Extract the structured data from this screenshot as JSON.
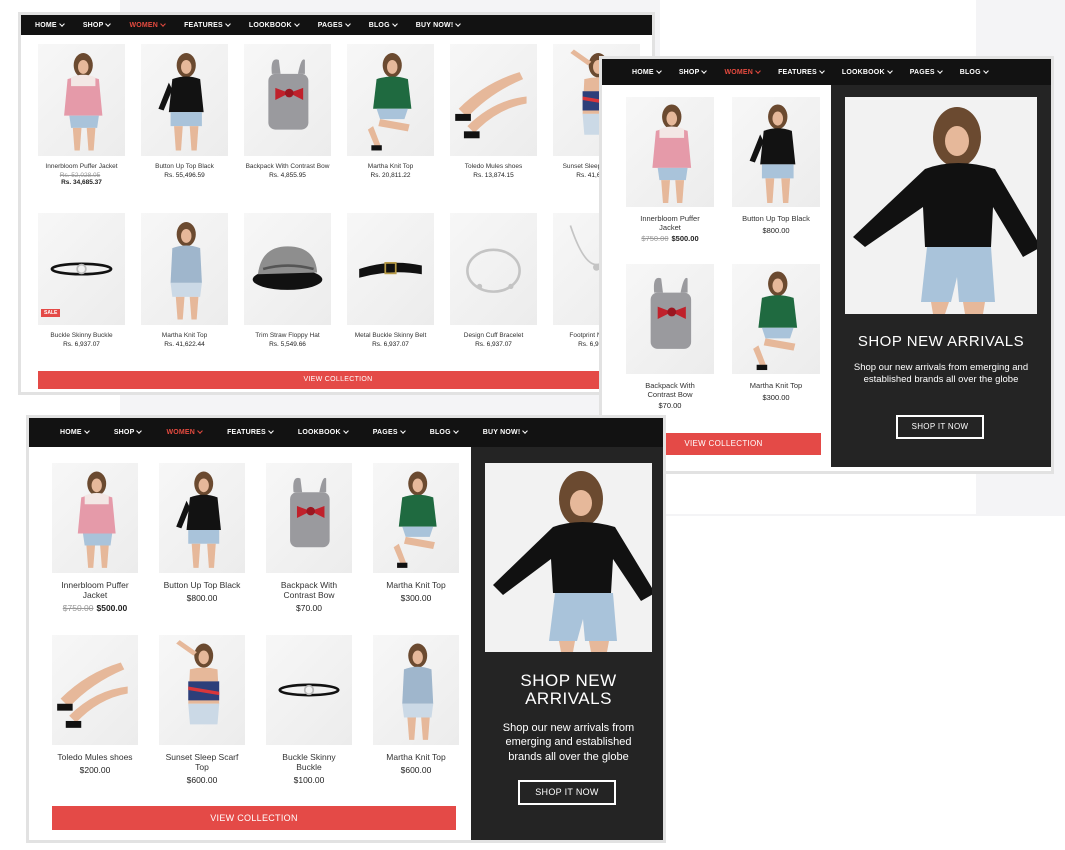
{
  "colors": {
    "nav_bg": "#121212",
    "accent": "#e44a3f",
    "button": "#e44a47",
    "promo_bg": "#242424"
  },
  "screen1": {
    "nav": [
      "HOME",
      "SHOP",
      "WOMEN",
      "FEATURES",
      "LOOKBOOK",
      "PAGES",
      "BLOG",
      "BUY NOW!"
    ],
    "products": [
      {
        "name": "Innerbloom Puffer Jacket",
        "old": "Rs. 52,028.05",
        "price": "Rs. 34,685.37",
        "kind": "woman-pink"
      },
      {
        "name": "Button Up Top Black",
        "old": "",
        "price": "Rs. 55,496.59",
        "kind": "woman-black"
      },
      {
        "name": "Backpack With Contrast Bow",
        "old": "",
        "price": "Rs. 4,855.95",
        "kind": "backpack"
      },
      {
        "name": "Martha Knit Top",
        "old": "",
        "price": "Rs. 20,811.22",
        "kind": "woman-green"
      },
      {
        "name": "Toledo Mules shoes",
        "old": "",
        "price": "Rs. 13,874.15",
        "kind": "legs"
      },
      {
        "name": "Sunset Sleep Scarf Top",
        "old": "",
        "price": "Rs. 41,622.44",
        "kind": "woman-scarf"
      },
      {
        "name": "Buckle Skinny Buckle",
        "old": "",
        "price": "Rs. 6,937.07",
        "kind": "belt-thin",
        "badge": "SALE"
      },
      {
        "name": "Martha Knit Top",
        "old": "",
        "price": "Rs. 41,622.44",
        "kind": "woman-denim"
      },
      {
        "name": "Trim Straw Floppy Hat",
        "old": "",
        "price": "Rs. 5,549.66",
        "kind": "hat"
      },
      {
        "name": "Metal Buckle Skinny Belt",
        "old": "",
        "price": "Rs. 6,937.07",
        "kind": "belt"
      },
      {
        "name": "Design Cuff Bracelet",
        "old": "",
        "price": "Rs. 6,937.07",
        "kind": "bracelet"
      },
      {
        "name": "Footprint Necklace",
        "old": "",
        "price": "Rs. 6,937.07",
        "kind": "necklace"
      }
    ],
    "button": "VIEW COLLECTION"
  },
  "screen2": {
    "nav": [
      "HOME",
      "SHOP",
      "WOMEN",
      "FEATURES",
      "LOOKBOOK",
      "PAGES",
      "BLOG"
    ],
    "products": [
      {
        "name": "Innerbloom Puffer Jacket",
        "old": "$750.00",
        "price": "$500.00",
        "kind": "woman-pink"
      },
      {
        "name": "Button Up Top Black",
        "old": "",
        "price": "$800.00",
        "kind": "woman-black"
      },
      {
        "name": "Backpack With Contrast Bow",
        "old": "",
        "price": "$70.00",
        "kind": "backpack"
      },
      {
        "name": "Martha Knit Top",
        "old": "",
        "price": "$300.00",
        "kind": "woman-green"
      }
    ],
    "button": "VIEW COLLECTION",
    "promo": {
      "title": "SHOP NEW ARRIVALS",
      "text": "Shop our new arrivals from emerging and established brands all over the globe",
      "button": "SHOP IT NOW"
    }
  },
  "screen3": {
    "nav": [
      "HOME",
      "SHOP",
      "WOMEN",
      "FEATURES",
      "LOOKBOOK",
      "PAGES",
      "BLOG",
      "BUY NOW!"
    ],
    "products": [
      {
        "name": "Innerbloom Puffer Jacket",
        "old": "$750.00",
        "price": "$500.00",
        "kind": "woman-pink"
      },
      {
        "name": "Button Up Top Black",
        "old": "",
        "price": "$800.00",
        "kind": "woman-black"
      },
      {
        "name": "Backpack With Contrast Bow",
        "old": "",
        "price": "$70.00",
        "kind": "backpack"
      },
      {
        "name": "Martha Knit Top",
        "old": "",
        "price": "$300.00",
        "kind": "woman-green"
      },
      {
        "name": "Toledo Mules shoes",
        "old": "",
        "price": "$200.00",
        "kind": "legs"
      },
      {
        "name": "Sunset Sleep Scarf Top",
        "old": "",
        "price": "$600.00",
        "kind": "woman-scarf"
      },
      {
        "name": "Buckle Skinny Buckle",
        "old": "",
        "price": "$100.00",
        "kind": "belt-thin"
      },
      {
        "name": "Martha Knit Top",
        "old": "",
        "price": "$600.00",
        "kind": "woman-denim"
      }
    ],
    "button": "VIEW COLLECTION",
    "promo": {
      "title": "SHOP NEW ARRIVALS",
      "text": "Shop our new arrivals from emerging and established brands all over the globe",
      "button": "SHOP IT NOW"
    }
  }
}
